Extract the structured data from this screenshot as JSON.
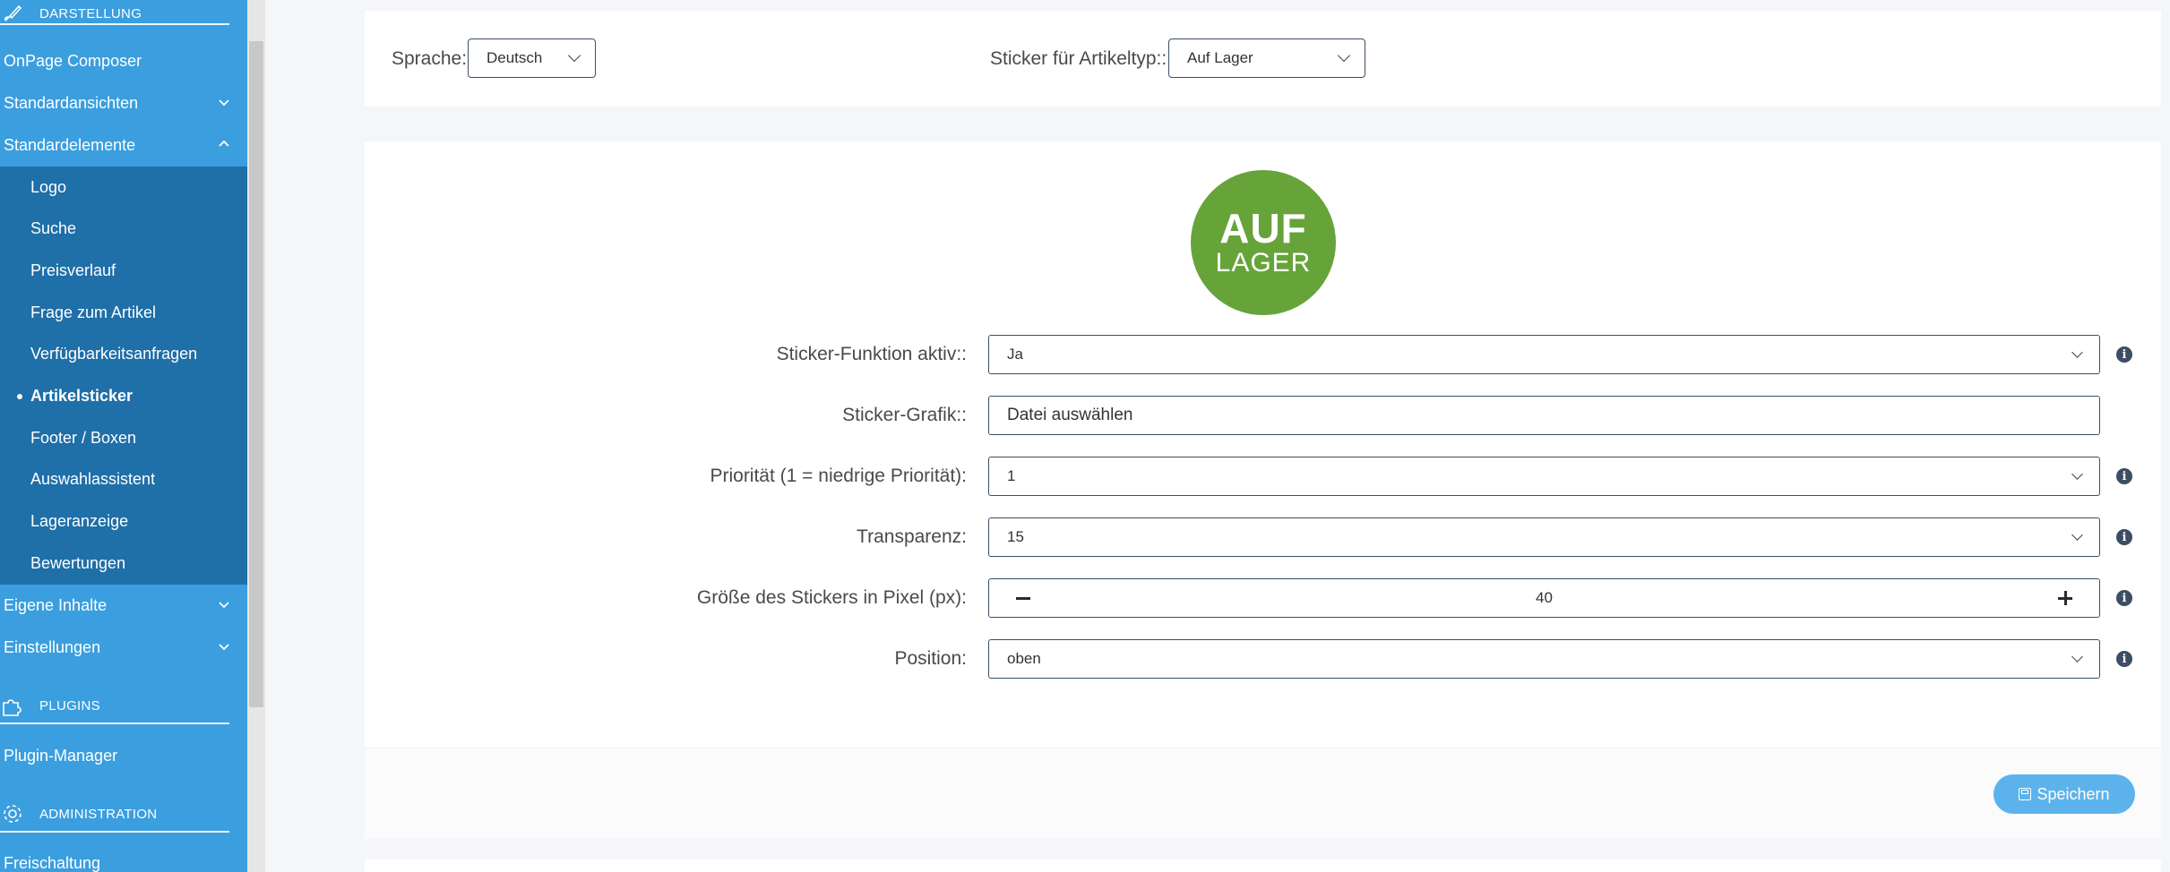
{
  "sidebar": {
    "sections": {
      "darstellung": "DARSTELLUNG",
      "plugins": "PLUGINS",
      "administration": "ADMINISTRATION"
    },
    "items": {
      "onpage_composer": "OnPage Composer",
      "standardansichten": "Standardansichten",
      "standardelemente": "Standardelemente",
      "eigene_inhalte": "Eigene Inhalte",
      "einstellungen": "Einstellungen",
      "plugin_manager": "Plugin-Manager",
      "freischaltung": "Freischaltung"
    },
    "subitems": [
      "Logo",
      "Suche",
      "Preisverlauf",
      "Frage zum Artikel",
      "Verfügbarkeitsanfragen",
      "Artikelsticker",
      "Footer / Boxen",
      "Auswahlassistent",
      "Lageranzeige",
      "Bewertungen"
    ],
    "active_subitem": "Artikelsticker"
  },
  "filters": {
    "language_label": "Sprache:",
    "language_value": "Deutsch",
    "sticker_type_label": "Sticker für Artikeltyp::",
    "sticker_type_value": "Auf Lager"
  },
  "sticker_preview": {
    "line1": "AUF",
    "line2": "LAGER",
    "color": "#66a43a"
  },
  "form": {
    "active_label": "Sticker-Funktion aktiv::",
    "active_value": "Ja",
    "graphic_label": "Sticker-Grafik::",
    "graphic_value": "Datei auswählen",
    "priority_label": "Priorität (1 = niedrige Priorität):",
    "priority_value": "1",
    "transparency_label": "Transparenz:",
    "transparency_value": "15",
    "size_label": "Größe des Stickers in Pixel (px):",
    "size_value": "40",
    "position_label": "Position:",
    "position_value": "oben"
  },
  "actions": {
    "save_label": "Speichern"
  },
  "colors": {
    "sidebar": "#3b9ede",
    "submenu": "#1f6fa8",
    "save_button": "#5cb3ec"
  }
}
